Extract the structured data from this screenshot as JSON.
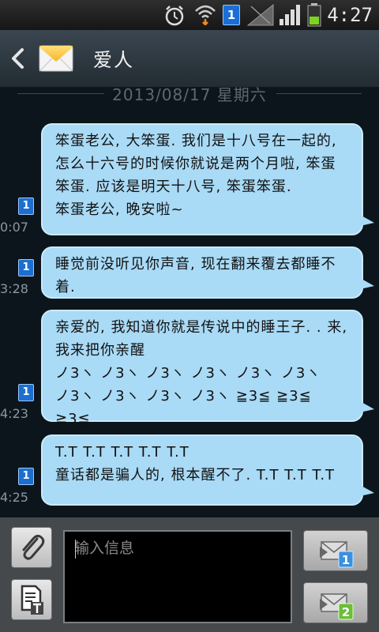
{
  "status": {
    "time": "4:27",
    "sim_number": "1"
  },
  "header": {
    "title": "爱人"
  },
  "date_divider": "2013/08/17 星期六",
  "messages": [
    {
      "time": "0:07",
      "sim": "1",
      "text": "笨蛋老公, 大笨蛋. 我们是十八号在一起的, 怎么十六号的时候你就说是两个月啦, 笨蛋笨蛋. 应该是明天十八号, 笨蛋笨蛋.\n笨蛋老公, 晚安啦~"
    },
    {
      "time": "3:28",
      "sim": "1",
      "text": "睡觉前没听见你声音, 现在翻来覆去都睡不着."
    },
    {
      "time": "4:23",
      "sim": "1",
      "text": "亲爱的, 我知道你就是传说中的睡王子. . 来, 我来把你亲醒\nノ3ヽ ノ3ヽ ノ3ヽ ノ3ヽ ノ3ヽ ノ3ヽ\nノ3ヽ ノ3ヽ ノ3ヽ ノ3ヽ ≧3≦ ≧3≦\n≧3≦"
    },
    {
      "time": "4:25",
      "sim": "1",
      "text": "T.T T.T T.T T.T T.T\n童话都是骗人的, 根本醒不了. T.T T.T T.T"
    }
  ],
  "composer": {
    "placeholder": "输入信息",
    "send_sim1": "1",
    "send_sim2": "2"
  },
  "colors": {
    "bubble": "#a9daf6",
    "background": "#0c151b",
    "sim_badge": "#1c6fd0"
  }
}
